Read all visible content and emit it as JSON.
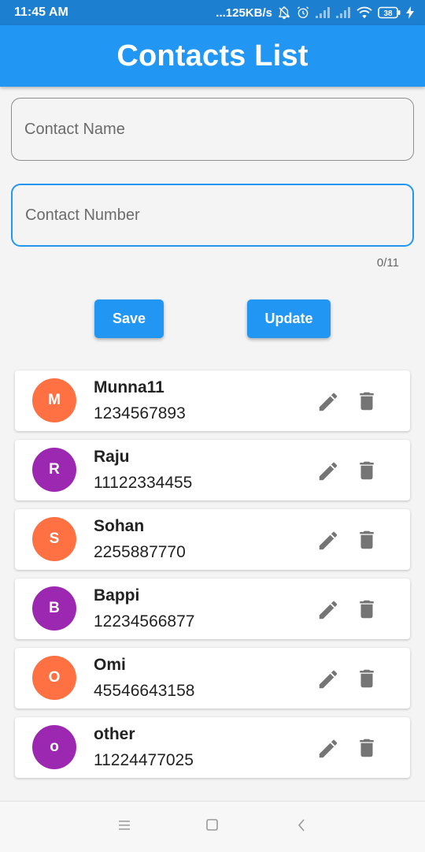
{
  "status_bar": {
    "time": "11:45 AM",
    "net_speed": "...125KB/s",
    "battery": "38"
  },
  "app_bar": {
    "title": "Contacts List"
  },
  "form": {
    "name_placeholder": "Contact Name",
    "number_placeholder": "Contact Number",
    "name_value": "",
    "number_value": "",
    "counter": "0/11",
    "save_label": "Save",
    "update_label": "Update"
  },
  "contacts": [
    {
      "initial": "M",
      "name": "Munna11",
      "number": "1234567893",
      "color": "#ff7043"
    },
    {
      "initial": "R",
      "name": "Raju",
      "number": "11122334455",
      "color": "#9c27b0"
    },
    {
      "initial": "S",
      "name": "Sohan",
      "number": "2255887770",
      "color": "#ff7043"
    },
    {
      "initial": "B",
      "name": "Bappi",
      "number": "12234566877",
      "color": "#9c27b0"
    },
    {
      "initial": "O",
      "name": "Omi",
      "number": "45546643158",
      "color": "#ff7043"
    },
    {
      "initial": "o",
      "name": "other",
      "number": "11224477025",
      "color": "#9c27b0"
    }
  ],
  "icons": {
    "edit": "pencil-icon",
    "delete": "trash-icon"
  },
  "colors": {
    "primary": "#2196f3",
    "status_bar": "#1c7fd0",
    "icon_grey": "#757575"
  }
}
